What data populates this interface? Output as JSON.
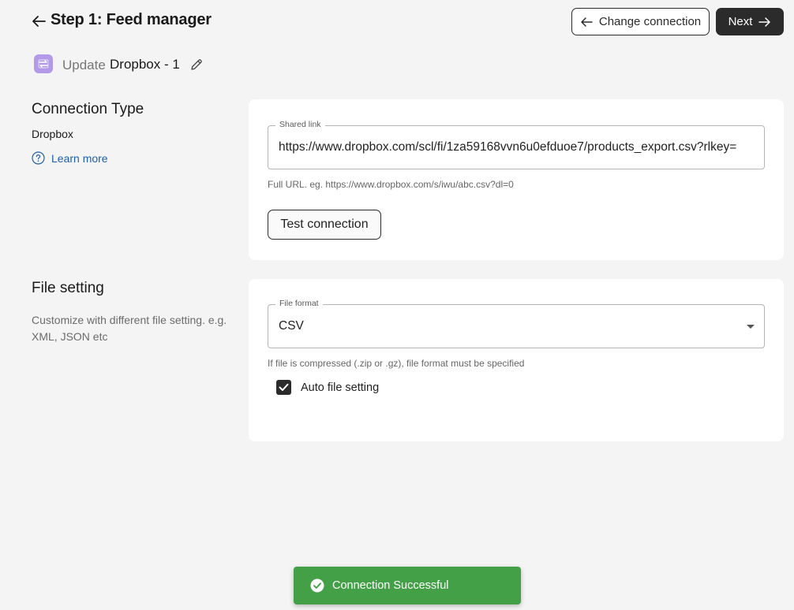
{
  "header": {
    "title": "Step 1: Feed manager",
    "change_connection_label": "Change connection",
    "next_label": "Next"
  },
  "feed": {
    "update_label": "Update",
    "name": "Dropbox - 1"
  },
  "connection_section": {
    "title": "Connection Type",
    "type": "Dropbox",
    "learn_more": "Learn more",
    "shared_link_label": "Shared link",
    "shared_link_value": "https://www.dropbox.com/scl/fi/1za59168vvn6u0efduoe7/products_export.csv?rlkey=",
    "helper": "Full URL. eg. https://www.dropbox.com/s/iwu/abc.csv?dl=0",
    "test_button": "Test connection"
  },
  "file_section": {
    "title": "File setting",
    "description": "Customize with different file setting. e.g. XML, JSON etc",
    "format_label": "File format",
    "format_value": "CSV",
    "helper": "If file is compressed (.zip or .gz), file format must be specified",
    "auto_label": "Auto file setting",
    "auto_checked": true
  },
  "toast": {
    "message": "Connection Successful",
    "color": "#43a047"
  },
  "colors": {
    "accent_dark": "#2b2b2b",
    "link": "#1f5fa8",
    "feed_icon": "#b39ae8"
  }
}
